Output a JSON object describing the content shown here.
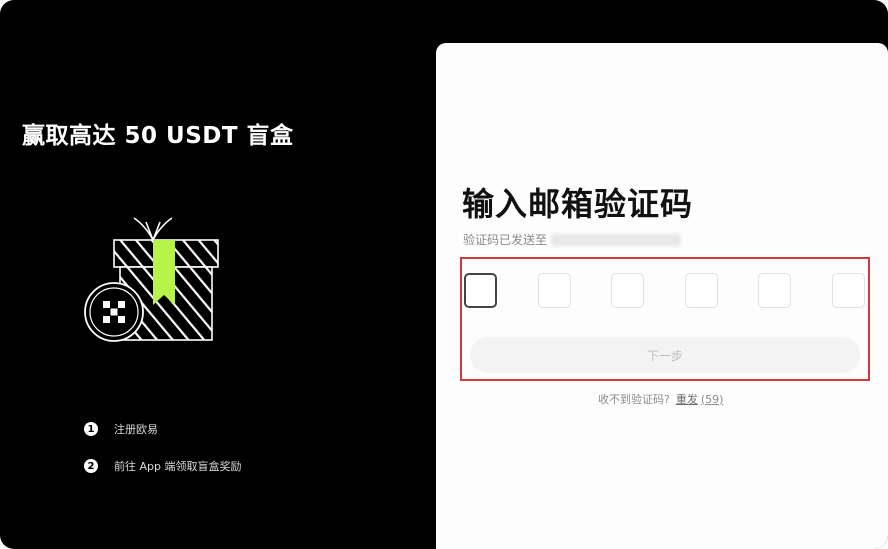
{
  "promo": {
    "title": "赢取高达 50 USDT 盲盒",
    "steps": [
      {
        "num": "1",
        "text": "注册欧易"
      },
      {
        "num": "2",
        "text": "前往 App 端领取盲盒奖励"
      }
    ]
  },
  "verify": {
    "title": "输入邮箱验证码",
    "sent_label": "验证码已发送至",
    "code_boxes": [
      "",
      "",
      "",
      "",
      "",
      ""
    ],
    "next_button": "下一步",
    "no_code_label": "收不到验证码?",
    "resend_label": "重发",
    "countdown": "(59)"
  },
  "colors": {
    "left_bg": "#000000",
    "accent_green": "#b8f34a",
    "highlight_red": "#d23b3b"
  }
}
